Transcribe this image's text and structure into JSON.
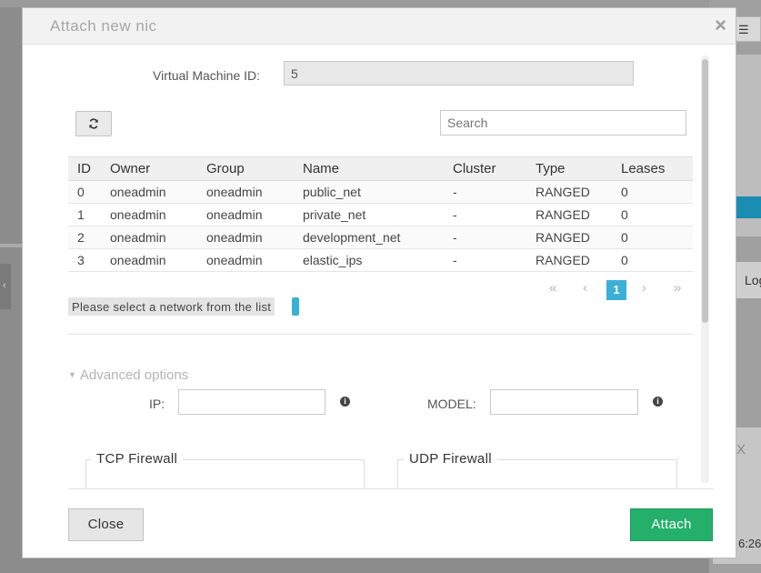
{
  "background": {
    "right_button_icon": "list-icon",
    "right_tab_label": "Log",
    "right_time_label": "6:26",
    "right_chart_close": "X",
    "left_tab_glyph": "‹"
  },
  "dialog": {
    "title": "Attach new nic",
    "close_glyph": "×"
  },
  "form": {
    "vm_id_label": "Virtual Machine ID:",
    "vm_id_value": "5",
    "refresh_icon": "refresh-icon",
    "search_placeholder": "Search"
  },
  "table": {
    "columns": [
      "ID",
      "Owner",
      "Group",
      "Name",
      "Cluster",
      "Type",
      "Leases"
    ],
    "rows": [
      [
        "0",
        "oneadmin",
        "oneadmin",
        "public_net",
        "-",
        "RANGED",
        "0"
      ],
      [
        "1",
        "oneadmin",
        "oneadmin",
        "private_net",
        "-",
        "RANGED",
        "0"
      ],
      [
        "2",
        "oneadmin",
        "oneadmin",
        "development_net",
        "-",
        "RANGED",
        "0"
      ],
      [
        "3",
        "oneadmin",
        "oneadmin",
        "elastic_ips",
        "-",
        "RANGED",
        "0"
      ]
    ]
  },
  "pagination": {
    "first": "«",
    "prev": "‹",
    "current": "1",
    "next": "›",
    "last": "»"
  },
  "notice": "Please select a network from the list",
  "advanced": {
    "toggle_label": "Advanced options",
    "ip_label": "IP:",
    "ip_value": "",
    "model_label": "MODEL:",
    "model_value": "",
    "tcp_legend": "TCP Firewall",
    "udp_legend": "UDP Firewall"
  },
  "footer": {
    "close_label": "Close",
    "attach_label": "Attach"
  },
  "colors": {
    "accent": "#3bb0d6",
    "attach": "#24b06a"
  }
}
